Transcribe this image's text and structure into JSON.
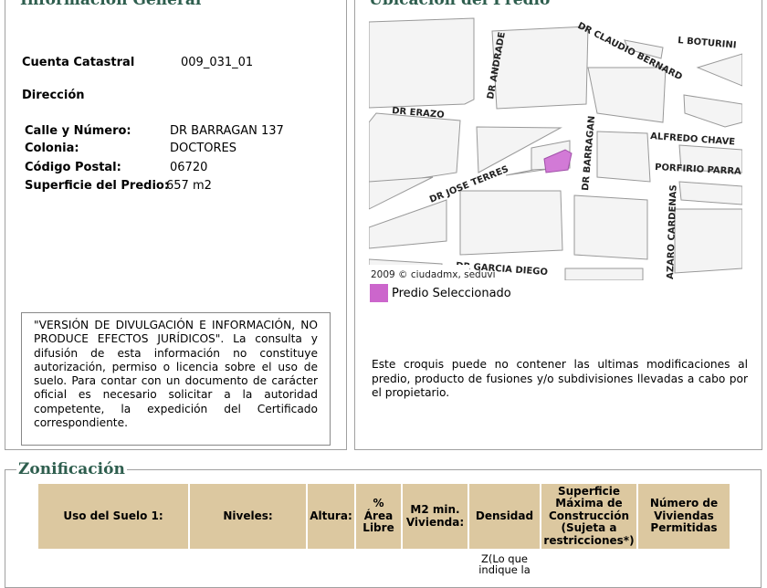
{
  "general": {
    "title": "Información General",
    "cuenta_label": "Cuenta Catastral",
    "cuenta_value": "009_031_01",
    "direccion_label": "Dirección",
    "fields": [
      {
        "label": "Calle y Número:",
        "value": "DR BARRAGAN 137"
      },
      {
        "label": "Colonia:",
        "value": "DOCTORES"
      },
      {
        "label": "Código Postal:",
        "value": "06720"
      },
      {
        "label": "Superficie del Predio:",
        "value": "657 m2"
      }
    ],
    "disclaimer": "\"VERSIÓN DE DIVULGACIÓN E INFORMACIÓN, NO PRODUCE EFECTOS JURÍDICOS\". La consulta y difusión de esta información no constituye autorización, permiso o licencia sobre el uso de suelo. Para contar con un documento de carácter oficial es necesario solicitar a la autoridad competente, la expedición del Certificado correspondiente."
  },
  "ubicacion": {
    "title": "Ubicación del Predio",
    "streets": [
      "DR CLAUDIO BERNARD",
      "L BOTURINI",
      "DR ANDRADE",
      "DR ERAZO",
      "DR BARRAGAN",
      "ALFREDO CHAVE",
      "PORFIRIO PARRA",
      "DR JOSE TERRES",
      "AZARO CARDENAS",
      "DR GARCIA DIEGO"
    ],
    "copyright": "2009 © ciudadmx, seduvi",
    "legend_label": "Predio Seleccionado",
    "legend_color": "#cc66cc",
    "note": "Este croquis puede no contener las ultimas modificaciones al predio, producto de fusiones y/o subdivisiones llevadas a cabo por el propietario."
  },
  "zonificacion": {
    "title": "Zonificación",
    "header_color": "#dcc8a0",
    "columns": [
      "Uso del Suelo 1:",
      "Niveles:",
      "Altura:",
      "% Área Libre",
      "M2 min. Vivienda:",
      "Densidad",
      "Superficie Máxima de Construcción (Sujeta a restricciones*)",
      "Número de Viviendas Permitidas"
    ],
    "row": [
      "",
      "",
      "",
      "",
      "",
      "Z(Lo que indique la",
      "",
      ""
    ]
  }
}
